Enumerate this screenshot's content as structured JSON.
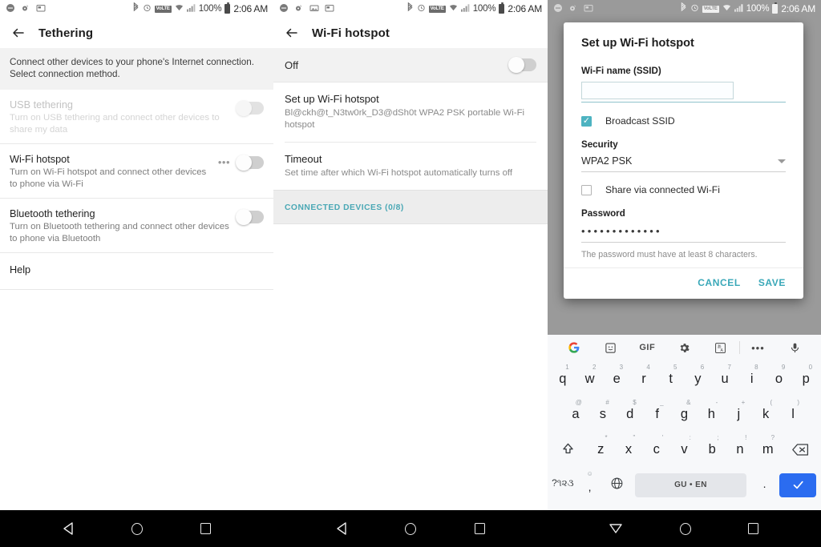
{
  "status_bar": {
    "notif_icons_panel1": [
      "minus-circle-icon",
      "bug-icon",
      "image-icon"
    ],
    "notif_icons_panel2": [
      "minus-circle-icon",
      "bug-icon",
      "picture-icon",
      "image-icon"
    ],
    "notif_icons_panel3": [
      "minus-circle-icon",
      "bug-icon",
      "image-icon"
    ],
    "bluetooth_icon": "bluetooth-icon",
    "alarm_icon": "alarm-icon",
    "volte_label": "VoLTE",
    "wifi_icon": "wifi-icon",
    "signal_icon": "cellular-signal-icon",
    "battery_percent": "100%",
    "battery_icon": "battery-full-icon",
    "time": "2:06 AM"
  },
  "panel1": {
    "appbar": {
      "back_icon": "back-arrow-icon",
      "title": "Tethering"
    },
    "intro": "Connect other devices to your phone's Internet connection. Select connection method.",
    "rows": [
      {
        "title": "USB tethering",
        "subtitle": "Turn on USB tethering and connect other devices to share my data",
        "disabled": true,
        "toggle_on": false,
        "has_overflow": false
      },
      {
        "title": "Wi-Fi hotspot",
        "subtitle": "Turn on Wi-Fi hotspot and connect other devices to phone via Wi-Fi",
        "disabled": false,
        "toggle_on": false,
        "has_overflow": true
      },
      {
        "title": "Bluetooth tethering",
        "subtitle": "Turn on Bluetooth tethering and connect other devices to phone via Bluetooth",
        "disabled": false,
        "toggle_on": false,
        "has_overflow": false
      }
    ],
    "help_label": "Help"
  },
  "panel2": {
    "appbar": {
      "back_icon": "back-arrow-icon",
      "title": "Wi-Fi hotspot"
    },
    "master_switch": {
      "label": "Off",
      "on": false
    },
    "items": [
      {
        "title": "Set up Wi-Fi hotspot",
        "subtitle": "Bl@ckh@t_N3tw0rk_D3@dSh0t WPA2 PSK portable Wi-Fi hotspot"
      },
      {
        "title": "Timeout",
        "subtitle": "Set time after which Wi-Fi hotspot automatically turns off"
      }
    ],
    "connected_devices_header": "CONNECTED DEVICES (0/8)",
    "accent_color": "#4aa8b5"
  },
  "dialog": {
    "title": "Set up Wi-Fi hotspot",
    "ssid_label": "Wi-Fi name (SSID)",
    "ssid_value": "",
    "broadcast_ssid": {
      "label": "Broadcast SSID",
      "checked": true
    },
    "security_label": "Security",
    "security_value": "WPA2 PSK",
    "share_via_wifi": {
      "label": "Share via connected Wi-Fi",
      "checked": false
    },
    "password_label": "Password",
    "password_masked": "•••••••••••••",
    "password_hint": "The password must have at least 8 characters.",
    "cancel_label": "CANCEL",
    "save_label": "SAVE",
    "accent_color": "#3aa8b8",
    "checkbox_color": "#4db3c1"
  },
  "keyboard": {
    "toolbar": [
      "google-logo-icon",
      "sticker-icon",
      "GIF",
      "gear-icon",
      "translate-icon",
      "overflow-dots-icon",
      "microphone-icon"
    ],
    "row1": [
      {
        "main": "q",
        "sup": "1"
      },
      {
        "main": "w",
        "sup": "2"
      },
      {
        "main": "e",
        "sup": "3"
      },
      {
        "main": "r",
        "sup": "4"
      },
      {
        "main": "t",
        "sup": "5"
      },
      {
        "main": "y",
        "sup": "6"
      },
      {
        "main": "u",
        "sup": "7"
      },
      {
        "main": "i",
        "sup": "8"
      },
      {
        "main": "o",
        "sup": "9"
      },
      {
        "main": "p",
        "sup": "0"
      }
    ],
    "row2": [
      {
        "main": "a",
        "sup": "@"
      },
      {
        "main": "s",
        "sup": "#"
      },
      {
        "main": "d",
        "sup": "$"
      },
      {
        "main": "f",
        "sup": "_"
      },
      {
        "main": "g",
        "sup": "&"
      },
      {
        "main": "h",
        "sup": "-"
      },
      {
        "main": "j",
        "sup": "+"
      },
      {
        "main": "k",
        "sup": "("
      },
      {
        "main": "l",
        "sup": ")"
      }
    ],
    "row3": [
      {
        "main": "z",
        "sup": "*"
      },
      {
        "main": "x",
        "sup": "\""
      },
      {
        "main": "c",
        "sup": "'"
      },
      {
        "main": "v",
        "sup": ":"
      },
      {
        "main": "b",
        "sup": ";"
      },
      {
        "main": "n",
        "sup": "!"
      },
      {
        "main": "m",
        "sup": "?"
      }
    ],
    "shift_icon": "shift-icon",
    "backspace_icon": "backspace-icon",
    "symbols_key": "?૧૨૩",
    "comma_key": ",",
    "comma_sup": "emoji-icon",
    "globe_icon": "globe-icon",
    "spacebar_label": "GU • EN",
    "period_key": ".",
    "enter_icon": "checkmark-icon",
    "enter_color": "#2b6cf0"
  },
  "navbar": {
    "segments": [
      {
        "back_icon": "back-triangle-icon",
        "home_icon": "home-circle-icon",
        "recents_icon": "recents-square-icon"
      },
      {
        "back_icon": "back-triangle-icon",
        "home_icon": "home-circle-icon",
        "recents_icon": "recents-square-icon"
      },
      {
        "back_icon": "hide-keyboard-icon",
        "home_icon": "home-circle-icon",
        "recents_icon": "recents-square-icon"
      }
    ]
  }
}
